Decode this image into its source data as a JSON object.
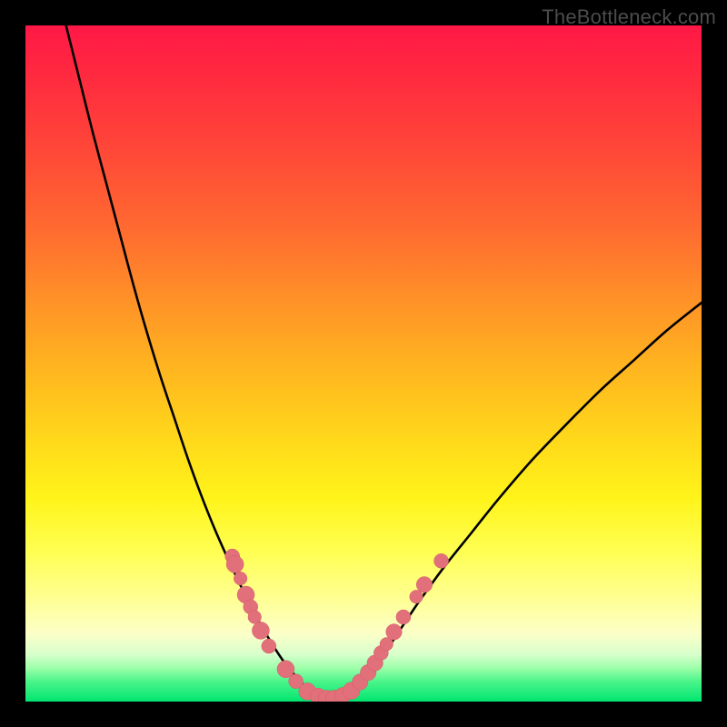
{
  "watermark": "TheBottleneck.com",
  "colors": {
    "frame": "#000000",
    "curve": "#000000",
    "marker_fill": "#e2707b",
    "marker_stroke": "#d35a66",
    "gradient_top": "#ff1846",
    "gradient_bottom": "#00e56f"
  },
  "chart_data": {
    "type": "line",
    "title": "",
    "xlabel": "",
    "ylabel": "",
    "xlim": [
      0,
      100
    ],
    "ylim": [
      0,
      100
    ],
    "grid": false,
    "legend": false,
    "series": [
      {
        "name": "left-curve",
        "x": [
          6,
          8,
          10,
          12,
          14,
          16,
          18,
          20,
          22,
          24,
          26,
          28,
          30,
          32,
          33.5,
          35,
          36.5,
          38,
          39.5,
          41,
          42.5
        ],
        "y": [
          100,
          92,
          84,
          76.5,
          69,
          61.5,
          54.5,
          48,
          42,
          36,
          30.5,
          25.5,
          21,
          16.8,
          13.8,
          11,
          8.5,
          6.2,
          4.3,
          2.6,
          1.3
        ]
      },
      {
        "name": "right-curve",
        "x": [
          47.5,
          49,
          50.5,
          52,
          54,
          56,
          58.5,
          62,
          66,
          70,
          75,
          80,
          85,
          90,
          95,
          100
        ],
        "y": [
          1.3,
          2.6,
          4.1,
          5.9,
          8.5,
          11.5,
          15.2,
          20,
          25,
          30,
          35.8,
          41,
          46,
          50.5,
          55,
          59
        ]
      },
      {
        "name": "floor",
        "x": [
          42.5,
          44,
          45,
          46,
          47.5
        ],
        "y": [
          1.3,
          0.6,
          0.4,
          0.6,
          1.3
        ]
      }
    ],
    "markers": [
      {
        "x": 30.6,
        "y": 21.5,
        "r": 1.1
      },
      {
        "x": 31.0,
        "y": 20.3,
        "r": 1.3
      },
      {
        "x": 31.8,
        "y": 18.2,
        "r": 1.0
      },
      {
        "x": 32.6,
        "y": 15.8,
        "r": 1.3
      },
      {
        "x": 33.3,
        "y": 14.0,
        "r": 1.1
      },
      {
        "x": 33.9,
        "y": 12.5,
        "r": 1.0
      },
      {
        "x": 34.8,
        "y": 10.5,
        "r": 1.3
      },
      {
        "x": 36.0,
        "y": 8.2,
        "r": 1.1
      },
      {
        "x": 38.5,
        "y": 4.8,
        "r": 1.3
      },
      {
        "x": 40.0,
        "y": 3.0,
        "r": 1.1
      },
      {
        "x": 41.7,
        "y": 1.5,
        "r": 1.3
      },
      {
        "x": 43.3,
        "y": 0.8,
        "r": 1.2
      },
      {
        "x": 44.5,
        "y": 0.5,
        "r": 1.2
      },
      {
        "x": 45.6,
        "y": 0.5,
        "r": 1.2
      },
      {
        "x": 46.9,
        "y": 0.9,
        "r": 1.2
      },
      {
        "x": 48.2,
        "y": 1.6,
        "r": 1.3
      },
      {
        "x": 49.5,
        "y": 2.9,
        "r": 1.2
      },
      {
        "x": 50.7,
        "y": 4.3,
        "r": 1.2
      },
      {
        "x": 51.7,
        "y": 5.7,
        "r": 1.2
      },
      {
        "x": 52.6,
        "y": 7.2,
        "r": 1.1
      },
      {
        "x": 53.4,
        "y": 8.5,
        "r": 1.0
      },
      {
        "x": 54.5,
        "y": 10.3,
        "r": 1.2
      },
      {
        "x": 55.9,
        "y": 12.5,
        "r": 1.1
      },
      {
        "x": 57.8,
        "y": 15.5,
        "r": 1.0
      },
      {
        "x": 59.0,
        "y": 17.3,
        "r": 1.2
      },
      {
        "x": 61.5,
        "y": 20.8,
        "r": 1.1
      }
    ]
  }
}
